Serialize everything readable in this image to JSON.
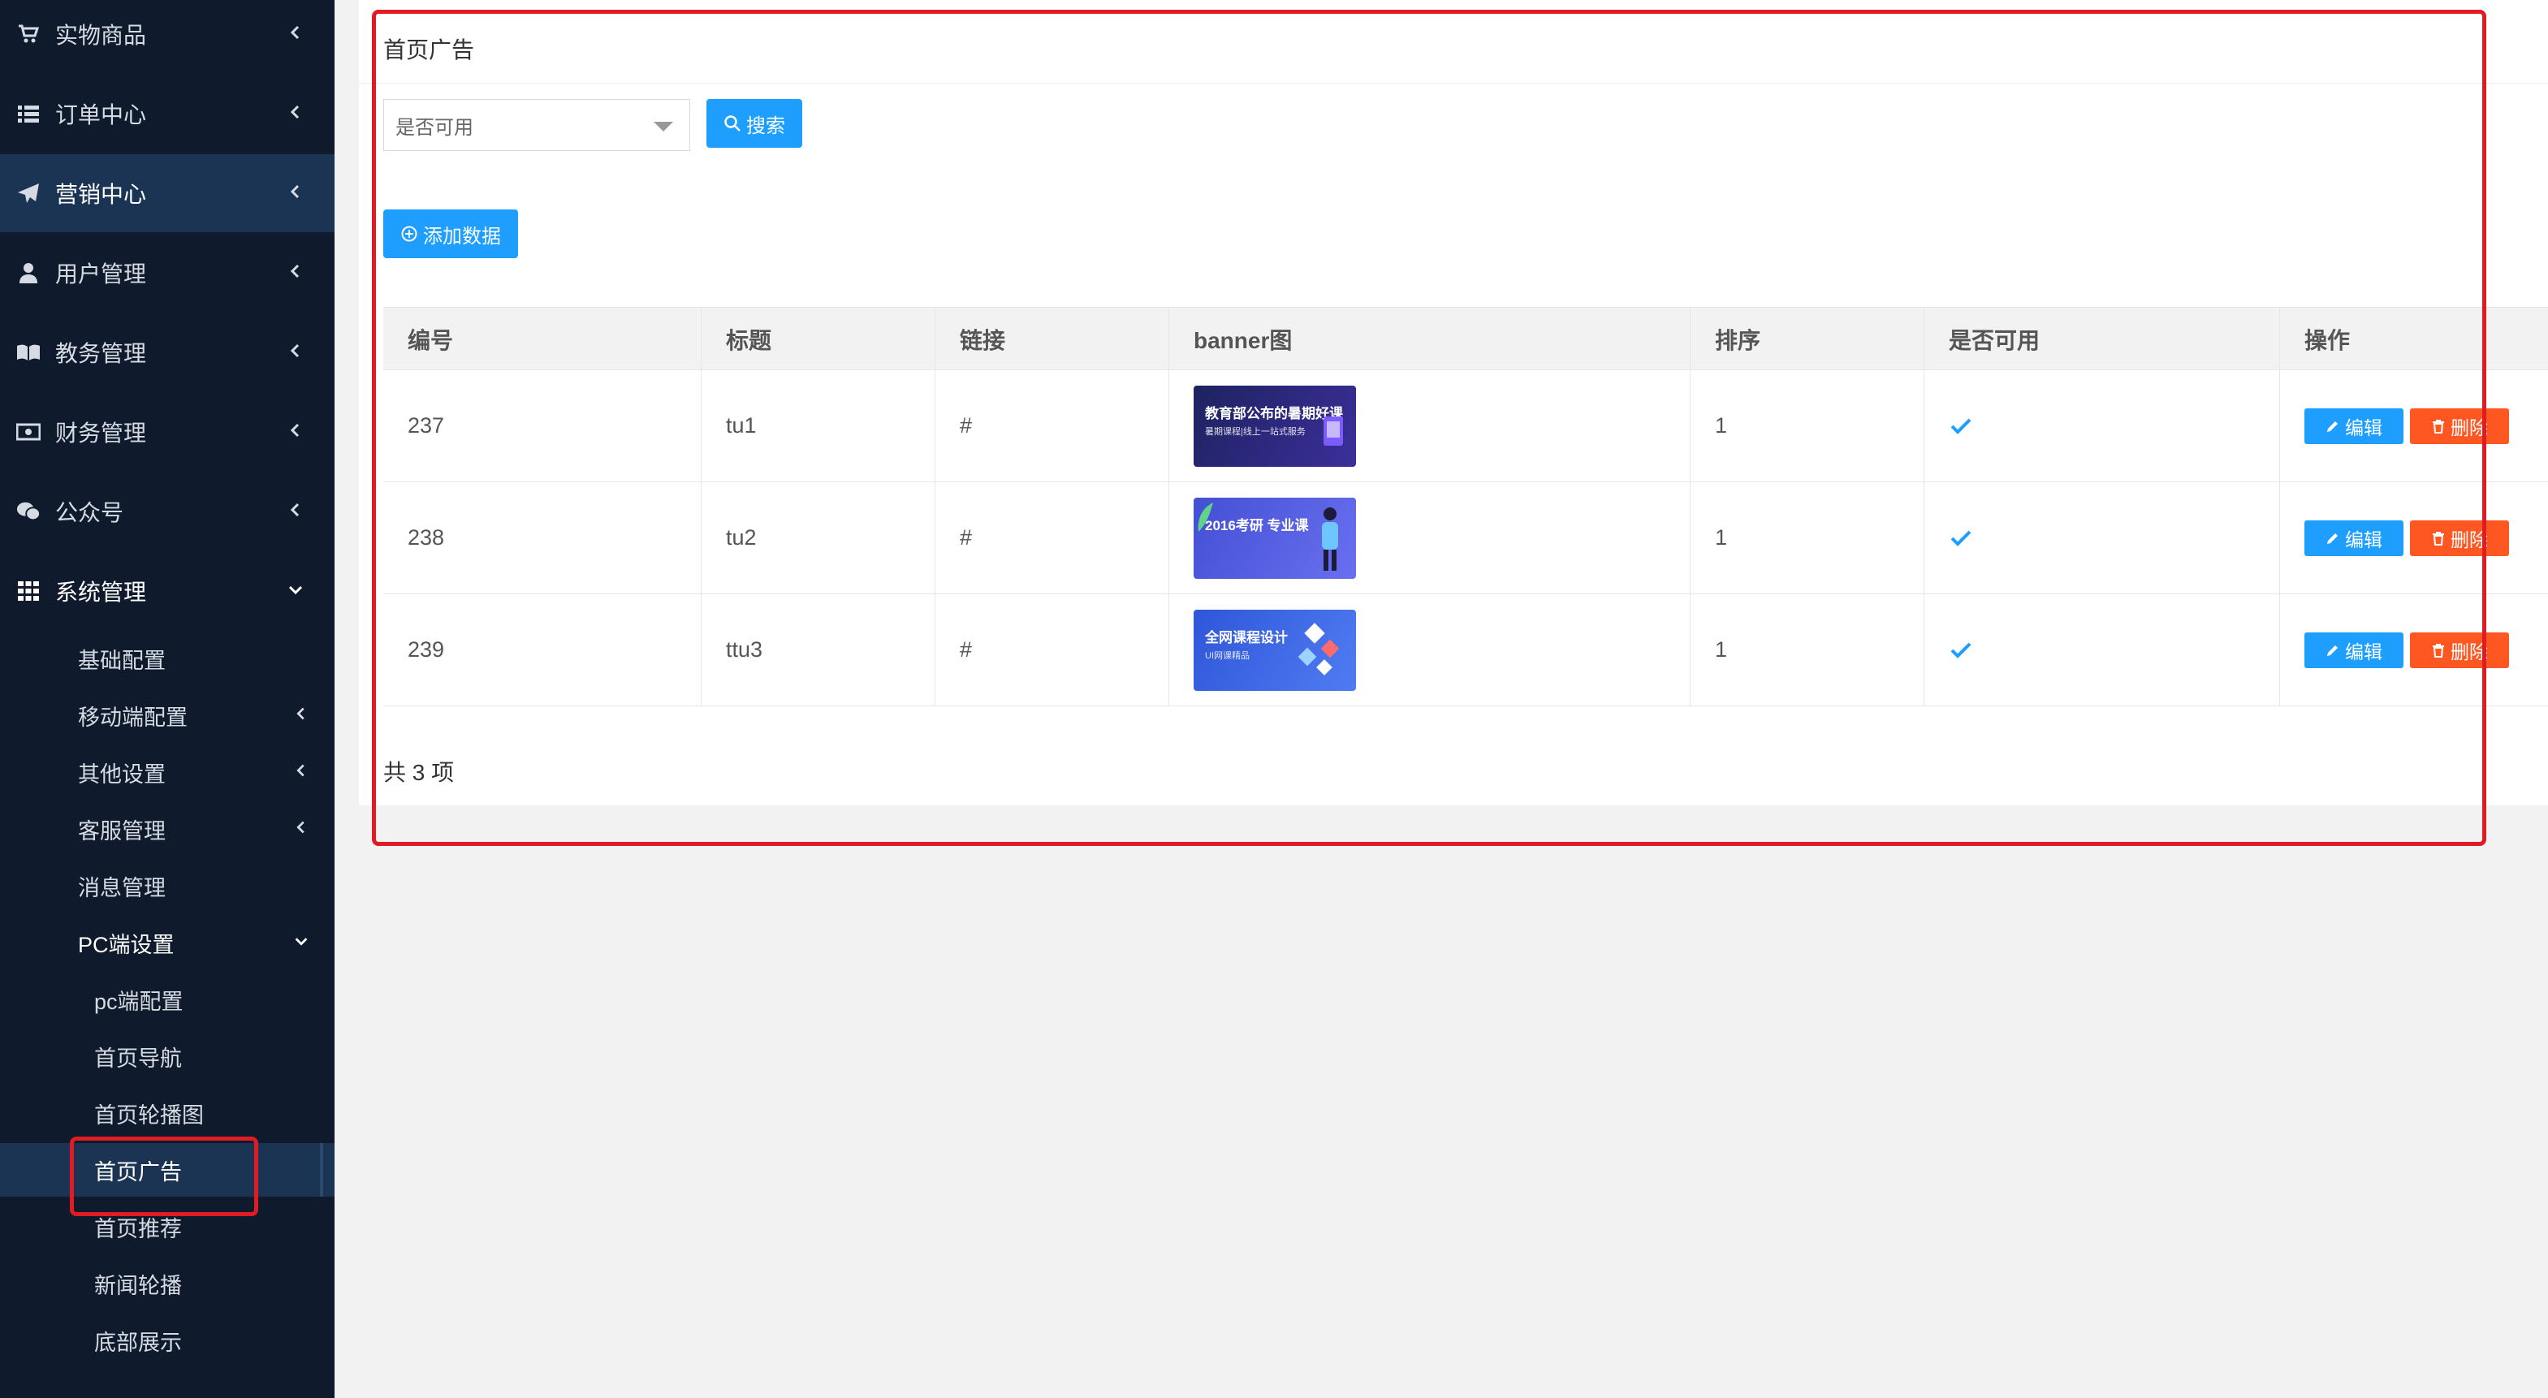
{
  "sidebar": {
    "menu": [
      {
        "label": "实物商品",
        "icon": "cart-icon",
        "expanded": false,
        "active": false
      },
      {
        "label": "订单中心",
        "icon": "list-icon",
        "expanded": false,
        "active": false
      },
      {
        "label": "营销中心",
        "icon": "paper-plane-icon",
        "expanded": false,
        "active": true
      },
      {
        "label": "用户管理",
        "icon": "user-icon",
        "expanded": false,
        "active": false
      },
      {
        "label": "教务管理",
        "icon": "book-icon",
        "expanded": false,
        "active": false
      },
      {
        "label": "财务管理",
        "icon": "money-icon",
        "expanded": false,
        "active": false
      },
      {
        "label": "公众号",
        "icon": "wechat-icon",
        "expanded": false,
        "active": false
      },
      {
        "label": "系统管理",
        "icon": "grid-icon",
        "expanded": true,
        "active": false
      }
    ],
    "system_sub": [
      {
        "label": "基础配置",
        "has_children": false
      },
      {
        "label": "移动端配置",
        "has_children": true
      },
      {
        "label": "其他设置",
        "has_children": true
      },
      {
        "label": "客服管理",
        "has_children": true
      },
      {
        "label": "消息管理",
        "has_children": false
      },
      {
        "label": "PC端设置",
        "has_children": true,
        "expanded": true
      }
    ],
    "pc_sub": [
      {
        "label": "pc端配置"
      },
      {
        "label": "首页导航"
      },
      {
        "label": "首页轮播图"
      },
      {
        "label": "首页广告",
        "selected": true
      },
      {
        "label": "首页推荐"
      },
      {
        "label": "新闻轮播"
      },
      {
        "label": "底部展示"
      }
    ]
  },
  "main": {
    "title": "首页广告",
    "filter": {
      "select_placeholder": "是否可用",
      "search_label": "搜索"
    },
    "add_label": "添加数据",
    "table": {
      "columns": [
        "编号",
        "标题",
        "链接",
        "banner图",
        "排序",
        "是否可用",
        "操作"
      ],
      "rows": [
        {
          "id": "237",
          "title": "tu1",
          "link": "#",
          "banner_text": "教育部公布的暑期好课",
          "banner_sub": "暑期课程|线上一站式服务",
          "banner_color": "#2b2f7a",
          "sort": "1",
          "enabled": true
        },
        {
          "id": "238",
          "title": "tu2",
          "link": "#",
          "banner_text": "2016考研 专业课",
          "banner_sub": "",
          "banner_color": "#4b57d6",
          "sort": "1",
          "enabled": true
        },
        {
          "id": "239",
          "title": "ttu3",
          "link": "#",
          "banner_text": "全网课程设计",
          "banner_sub": "UI网课精品",
          "banner_color": "#3e63e0",
          "sort": "1",
          "enabled": true
        }
      ],
      "edit_label": "编辑",
      "delete_label": "删除"
    },
    "total": "共 3 项"
  },
  "colors": {
    "sidebar_bg": "#0f1a2c",
    "sidebar_active": "#1b3454",
    "primary": "#1e9fff",
    "danger": "#ff5722",
    "highlight": "#e01b24"
  }
}
